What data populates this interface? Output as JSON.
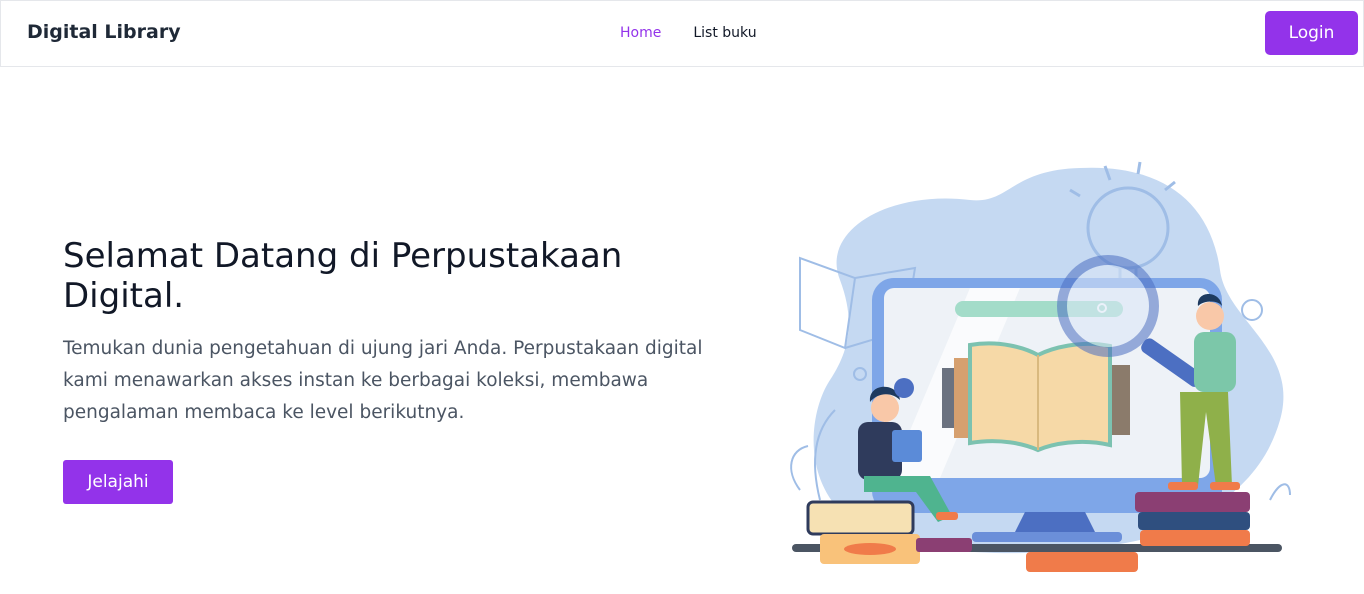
{
  "navbar": {
    "brand": "Digital Library",
    "links": [
      {
        "label": "Home",
        "active": true
      },
      {
        "label": "List buku",
        "active": false
      }
    ],
    "login_label": "Login"
  },
  "hero": {
    "title": "Selamat Datang di Perpustakaan Digital.",
    "description": "Temukan dunia pengetahuan di ujung jari Anda. Perpustakaan digital kami menawarkan akses instan ke berbagai koleksi, membawa pengalaman membaca ke level berikutnya.",
    "cta_label": "Jelajahi"
  },
  "illustration": {
    "name": "digital-library-illustration",
    "colors": {
      "blob": "#c5d9f2",
      "monitor": "#7ea6e8",
      "accent": "#9333ea"
    }
  }
}
